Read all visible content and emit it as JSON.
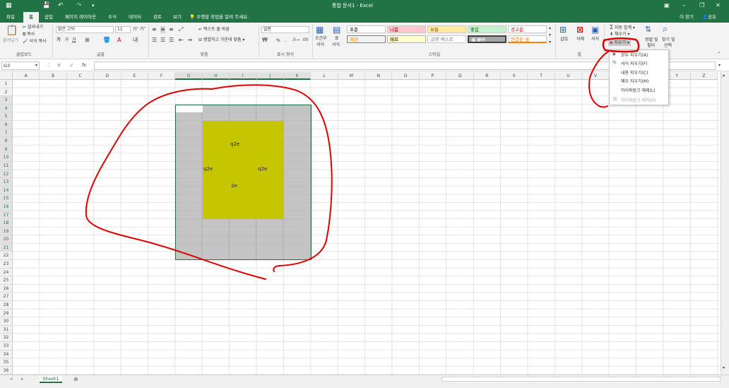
{
  "title": {
    "doc": "통합 문서1 - Excel",
    "signin": "이 창기",
    "share": "공유"
  },
  "tabs": [
    "파일",
    "홈",
    "삽입",
    "페이지 레이아웃",
    "수식",
    "데이터",
    "검토",
    "보기"
  ],
  "search_hint": "수행할 작업을 알려 주세요.",
  "clipboard": {
    "paste": "붙여넣기",
    "cut": "잘라내기",
    "copy": "복사",
    "format_painter": "서식 복사",
    "label": "클립보드"
  },
  "font": {
    "name": "맑은 고딕",
    "size": "11",
    "label": "글꼴",
    "bold": "가",
    "italic": "가",
    "underline": "가",
    "grow": "가",
    "shrink": "가"
  },
  "align": {
    "wrap": "텍스트 줄 바꿈",
    "merge": "병합하고 가운데 맞춤",
    "label": "맞춤"
  },
  "number": {
    "format": "일반",
    "label": "표시 형식",
    "percent": "%",
    "comma": ","
  },
  "styles": {
    "cond": "조건부",
    "cond2": "서식",
    "table": "표",
    "table2": "서식",
    "cells": [
      "표준",
      "나쁨",
      "보통",
      "좋음",
      "경고문",
      "계산",
      "메모",
      "설명 텍스트",
      "셀 확인",
      "연결된 셀"
    ],
    "label": "스타일"
  },
  "cells_group": {
    "insert": "삽입",
    "delete": "삭제",
    "format": "서식",
    "label": "셀"
  },
  "editing": {
    "autosum": "자동 합계",
    "fill": "채우기",
    "clear": "지우기",
    "sort": "정렬 및",
    "sort2": "필터",
    "find": "찾기 및",
    "find2": "선택"
  },
  "dropdown": [
    "모두 지우기(A)",
    "서식 지우기(F)",
    "내용 지우기(C)",
    "메모 지우기(M)",
    "하이퍼링크 해제(L)",
    "하이퍼링크 제거(R)"
  ],
  "formula_bar": {
    "name_box": "G3",
    "fx": "fx",
    "value": ""
  },
  "columns": [
    "A",
    "B",
    "C",
    "D",
    "E",
    "F",
    "G",
    "H",
    "I",
    "J",
    "K",
    "L",
    "M",
    "N",
    "O",
    "P",
    "Q",
    "R",
    "S",
    "T",
    "U",
    "V",
    "W",
    "X",
    "Y",
    "Z"
  ],
  "rows": [
    "1",
    "2",
    "3",
    "4",
    "5",
    "6",
    "7",
    "8",
    "9",
    "10",
    "11",
    "12",
    "13",
    "14",
    "15",
    "16",
    "17",
    "18",
    "19",
    "20",
    "21",
    "22",
    "23",
    "24",
    "25",
    "26",
    "27",
    "28",
    "29",
    "30",
    "31",
    "32",
    "33",
    "34",
    "35",
    "36"
  ],
  "cell_texts": {
    "i5": "q2e",
    "h10": "q2e",
    "j10": "q2e",
    "i12": "2e"
  },
  "sheet_tab": "Sheet1",
  "colors": {
    "excel_green": "#217346",
    "yellow": "#c5c600",
    "gray": "#c4c4c4",
    "annotation_red": "#e00000"
  }
}
